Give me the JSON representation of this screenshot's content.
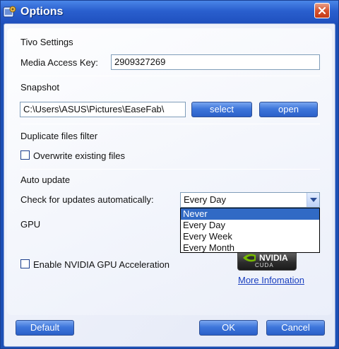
{
  "window": {
    "title": "Options"
  },
  "tivo": {
    "section_label": "Tivo Settings",
    "media_key_label": "Media Access Key:",
    "media_key_value": "2909327269"
  },
  "snapshot": {
    "section_label": "Snapshot",
    "path_value": "C:\\Users\\ASUS\\Pictures\\EaseFab\\",
    "select_label": "select",
    "open_label": "open"
  },
  "duplicate": {
    "section_label": "Duplicate files filter",
    "overwrite_label": "Overwrite existing files",
    "overwrite_checked": false
  },
  "auto_update": {
    "section_label": "Auto update",
    "check_label": "Check for updates automatically:",
    "selected_value": "Every Day",
    "options": [
      "Never",
      "Every Day",
      "Every Week",
      "Every Month"
    ],
    "highlighted_option": "Never"
  },
  "gpu": {
    "section_label": "GPU",
    "nvidia_label": "Enable NVIDIA GPU Acceleration",
    "nvidia_checked": false,
    "logo_text": "NVIDIA",
    "logo_subtext": "CUDA",
    "more_info_label": "More Infomation"
  },
  "footer": {
    "default_label": "Default",
    "ok_label": "OK",
    "cancel_label": "Cancel"
  },
  "colors": {
    "titlebar": "#2a5fce",
    "button": "#3e76db",
    "selection": "#316ac5",
    "link": "#1a3fbf"
  },
  "icons": {
    "app": "options-app-icon",
    "close": "close-icon",
    "combo_arrow": "chevron-down-icon"
  }
}
